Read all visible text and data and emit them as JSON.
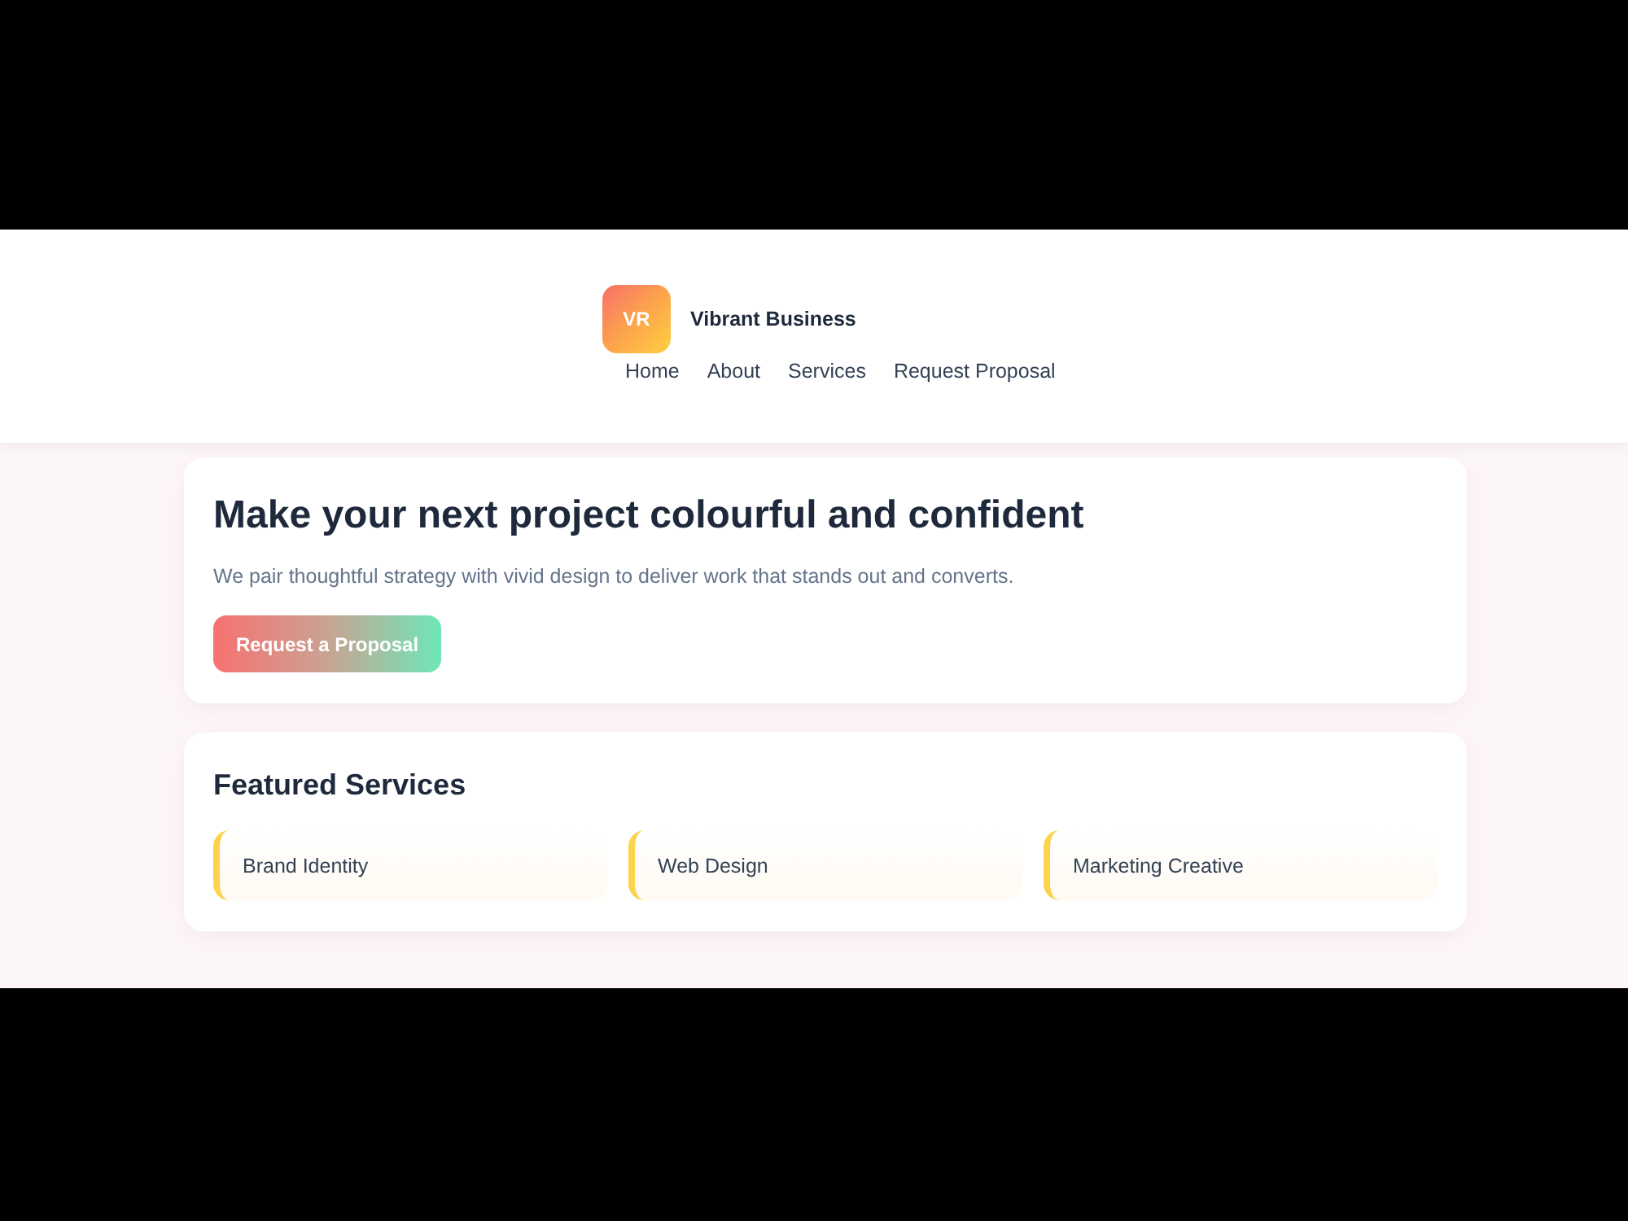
{
  "header": {
    "logo_text": "VR",
    "brand": "Vibrant Business",
    "nav": [
      {
        "label": "Home"
      },
      {
        "label": "About"
      },
      {
        "label": "Services"
      },
      {
        "label": "Request Proposal"
      }
    ]
  },
  "hero": {
    "title": "Make your next project colourful and confident",
    "subtitle": "We pair thoughtful strategy with vivid design to deliver work that stands out and converts.",
    "button": "Request a Proposal"
  },
  "services": {
    "title": "Featured Services",
    "items": [
      {
        "label": "Brand Identity"
      },
      {
        "label": "Web Design"
      },
      {
        "label": "Marketing Creative"
      }
    ]
  }
}
